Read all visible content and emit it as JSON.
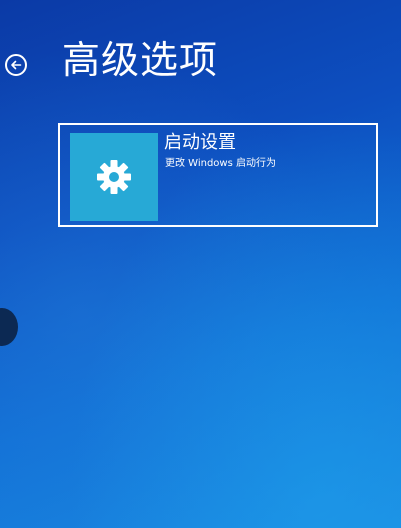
{
  "header": {
    "back_icon": "back-arrow-circle-icon",
    "title": "高级选项"
  },
  "options": [
    {
      "icon": "gear-icon",
      "icon_bg": "#27a9d6",
      "title": "启动设置",
      "description": "更改 Windows 启动行为"
    }
  ],
  "colors": {
    "background_top": "#0b3aa6",
    "background_bottom": "#1b8de3",
    "text": "#ffffff"
  }
}
